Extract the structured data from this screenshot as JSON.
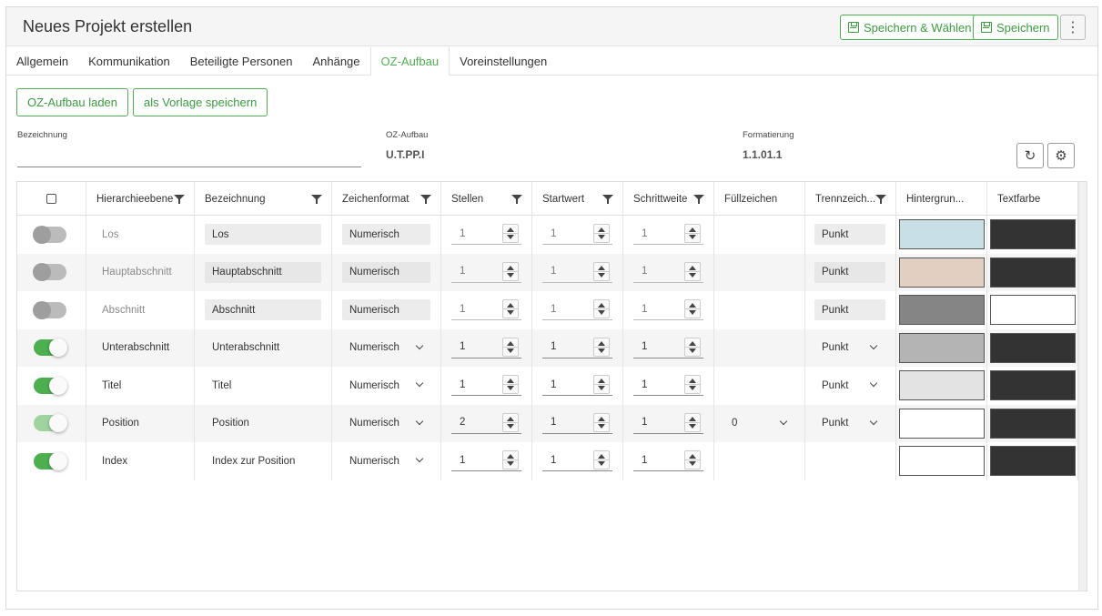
{
  "header": {
    "title": "Neues Projekt erstellen",
    "save_select_label": "Speichern & Wählen",
    "save_label": "Speichern",
    "more_icon": "more-vertical-icon"
  },
  "tabs": [
    {
      "label": "Allgemein",
      "active": false
    },
    {
      "label": "Kommunikation",
      "active": false
    },
    {
      "label": "Beteiligte Personen",
      "active": false
    },
    {
      "label": "Anhänge",
      "active": false
    },
    {
      "label": "OZ-Aufbau",
      "active": true
    },
    {
      "label": "Voreinstellungen",
      "active": false
    }
  ],
  "actions": {
    "load_label": "OZ-Aufbau laden",
    "save_template_label": "als Vorlage speichern"
  },
  "form": {
    "bezeichnung_label": "Bezeichnung",
    "bezeichnung_value": "",
    "ozaufbau_label": "OZ-Aufbau",
    "ozaufbau_value": "U.T.PP.I",
    "formatierung_label": "Formatierung",
    "formatierung_value": "1.1.01.1"
  },
  "colors": {
    "accent": "#4caf50"
  },
  "grid": {
    "columns": [
      "Hierarchieebene",
      "Bezeichnung",
      "Zeichenformat",
      "Stellen",
      "Startwert",
      "Schrittweite",
      "Füllzeichen",
      "Trennzeich...",
      "Hintergrun...",
      "Textfarbe"
    ],
    "rows": [
      {
        "enabled": false,
        "editable": false,
        "level": "Los",
        "name": "Los",
        "format": "Numerisch",
        "stellen": "1",
        "start": "1",
        "step": "1",
        "fill": "",
        "sep": "Punkt",
        "bg": "#c9dfe8",
        "fg": "#333333"
      },
      {
        "enabled": false,
        "editable": false,
        "level": "Hauptabschnitt",
        "name": "Hauptabschnitt",
        "format": "Numerisch",
        "stellen": "1",
        "start": "1",
        "step": "1",
        "fill": "",
        "sep": "Punkt",
        "bg": "#e2cfc1",
        "fg": "#333333"
      },
      {
        "enabled": false,
        "editable": false,
        "level": "Abschnitt",
        "name": "Abschnitt",
        "format": "Numerisch",
        "stellen": "1",
        "start": "1",
        "step": "1",
        "fill": "",
        "sep": "Punkt",
        "bg": "#858585",
        "fg": "#ffffff"
      },
      {
        "enabled": true,
        "editable": true,
        "level": "Unterabschnitt",
        "name": "Unterabschnitt",
        "format": "Numerisch",
        "stellen": "1",
        "start": "1",
        "step": "1",
        "fill": "",
        "sep": "Punkt",
        "bg": "#b4b4b4",
        "fg": "#333333"
      },
      {
        "enabled": true,
        "editable": true,
        "level": "Titel",
        "name": "Titel",
        "format": "Numerisch",
        "stellen": "1",
        "start": "1",
        "step": "1",
        "fill": "",
        "sep": "Punkt",
        "bg": "#e3e3e3",
        "fg": "#333333"
      },
      {
        "enabled": true,
        "editable": true,
        "light": true,
        "level": "Position",
        "name": "Position",
        "format": "Numerisch",
        "stellen": "2",
        "start": "1",
        "step": "1",
        "fill": "0",
        "sep": "Punkt",
        "bg": "#ffffff",
        "fg": "#333333"
      },
      {
        "enabled": true,
        "editable": true,
        "level": "Index",
        "name": "Index zur Position",
        "format": "Numerisch",
        "stellen": "1",
        "start": "1",
        "step": "1",
        "fill": "",
        "sep": "",
        "bg": "#ffffff",
        "fg": "#333333"
      }
    ]
  }
}
